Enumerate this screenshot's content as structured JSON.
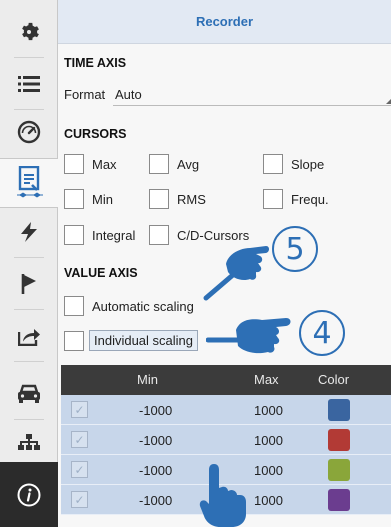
{
  "header": {
    "title": "Recorder"
  },
  "time_axis": {
    "title": "TIME AXIS",
    "format_label": "Format",
    "format_value": "Auto"
  },
  "cursors": {
    "title": "CURSORS",
    "options": [
      {
        "label": "Max",
        "checked": false
      },
      {
        "label": "Avg",
        "checked": false
      },
      {
        "label": "Slope",
        "checked": false
      },
      {
        "label": "Min",
        "checked": false
      },
      {
        "label": "RMS",
        "checked": false
      },
      {
        "label": "Frequ.",
        "checked": false
      },
      {
        "label": "Integral",
        "checked": false
      },
      {
        "label": "C/D-Cursors",
        "checked": false
      }
    ]
  },
  "value_axis": {
    "title": "VALUE AXIS",
    "automatic_scaling": {
      "label": "Automatic scaling",
      "checked": false
    },
    "individual_scaling": {
      "label": "Individual scaling",
      "checked": false
    }
  },
  "table": {
    "headers": {
      "min": "Min",
      "max": "Max",
      "color": "Color"
    },
    "rows": [
      {
        "checked": true,
        "min": "-1000",
        "max": "1000",
        "color": "#3a65a0"
      },
      {
        "checked": true,
        "min": "-1000",
        "max": "1000",
        "color": "#b23a35"
      },
      {
        "checked": true,
        "min": "-1000",
        "max": "1000",
        "color": "#8aa63a"
      },
      {
        "checked": true,
        "min": "-1000",
        "max": "1000",
        "color": "#6b3d8f"
      }
    ]
  },
  "callouts": [
    {
      "number": "5"
    },
    {
      "number": "4"
    }
  ],
  "sidebar": {
    "icons": [
      "gear-icon",
      "list-icon",
      "gauge-icon",
      "recorder-icon",
      "lightning-icon",
      "flag-icon",
      "share-icon",
      "car-icon",
      "network-icon",
      "info-icon"
    ],
    "active": "recorder-icon"
  },
  "colors": {
    "accent": "#2d6fb5",
    "header_bg": "#e2e9f3",
    "table_header": "#3b3b3b",
    "row_bg": "#c7d6ea"
  }
}
